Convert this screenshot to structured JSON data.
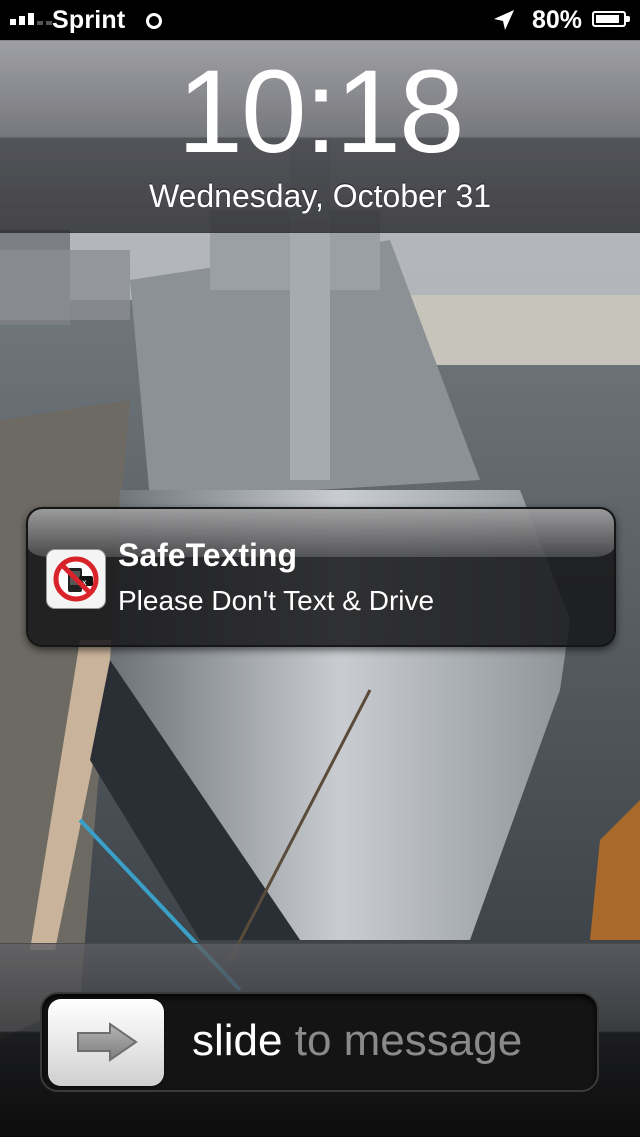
{
  "status_bar": {
    "carrier": "Sprint",
    "battery_percent": "80%",
    "signal_bars": 3,
    "icons": [
      "signal-icon",
      "activity-icon",
      "location-icon",
      "battery-icon"
    ]
  },
  "lock_screen": {
    "time": "10:18",
    "date": "Wednesday, October 31"
  },
  "notification": {
    "app_name": "SafeTexting",
    "message": "Please Don't Text & Drive",
    "icon": "no-texting-icon"
  },
  "slider": {
    "label_bright": "slide",
    "label_dim": " to message",
    "icon": "arrow-right-icon"
  },
  "colors": {
    "text": "#ffffff",
    "slider_dim_text": "#8a8a8a",
    "notification_bg": "#161618",
    "no_sign_red": "#d8232a"
  }
}
